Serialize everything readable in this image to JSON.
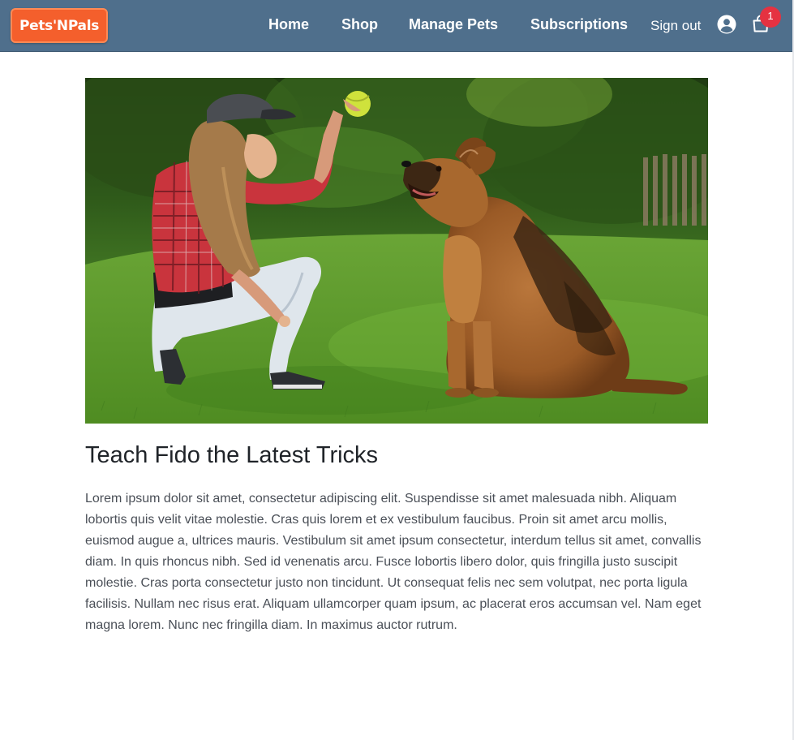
{
  "brand": {
    "logo_text": "Pets'NPals",
    "logo_color": "#f45f2c"
  },
  "header": {
    "background_color": "#4f6f8c",
    "nav": [
      {
        "label": "Home"
      },
      {
        "label": "Shop"
      },
      {
        "label": "Manage Pets"
      },
      {
        "label": "Subscriptions"
      }
    ],
    "sign_out_label": "Sign out",
    "account_icon": "user-circle-icon",
    "cart_icon": "shopping-bag-icon",
    "cart_count": "1",
    "badge_color": "#e53241"
  },
  "article": {
    "image_alt": "Woman in a plaid shirt holding up a tennis ball for a German Shepherd sitting on grass",
    "title": "Teach Fido the Latest Tricks",
    "body": "Lorem ipsum dolor sit amet, consectetur adipiscing elit. Suspendisse sit amet malesuada nibh. Aliquam lobortis quis velit vitae molestie. Cras quis lorem et ex vestibulum faucibus. Proin sit amet arcu mollis, euismod augue a, ultrices mauris. Vestibulum sit amet ipsum consectetur, interdum tellus sit amet, convallis diam. In quis rhoncus nibh. Sed id venenatis arcu. Fusce lobortis libero dolor, quis fringilla justo suscipit molestie. Cras porta consectetur justo non tincidunt. Ut consequat felis nec sem volutpat, nec porta ligula facilisis. Nullam nec risus erat. Aliquam ullamcorper quam ipsum, ac placerat eros accumsan vel. Nam eget magna lorem. Nunc nec fringilla diam. In maximus auctor rutrum."
  }
}
